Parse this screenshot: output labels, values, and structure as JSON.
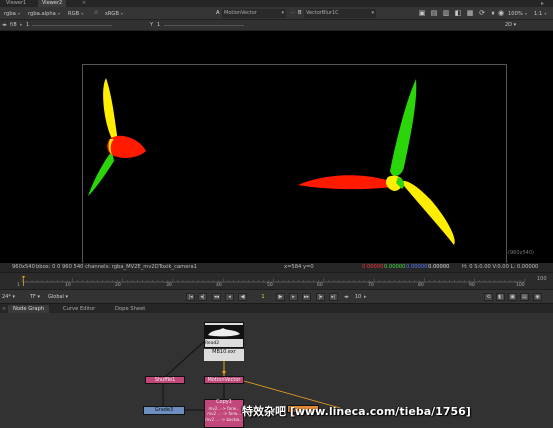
{
  "tabs": [
    {
      "label": "Viewer1",
      "active": false
    },
    {
      "label": "Viewer2",
      "active": true
    }
  ],
  "toolbar": {
    "channels": "rgba",
    "alpha": "rgba.alpha",
    "colorspace_mode": "RGB",
    "colorspace": "sRGB",
    "input_a_letter": "A",
    "input_a": "MotionVector",
    "input_b_letter": "B",
    "input_b": "VectorBlur1C",
    "zoom": "100%",
    "ratio": "1:1"
  },
  "toolbar2": {
    "fstop": "f/8",
    "frame": "1",
    "y_label": "Y",
    "y_value": "1",
    "view_mode": "2D"
  },
  "viewer": {
    "resolution_label": "(960x540)"
  },
  "infobar": {
    "format": "960x540",
    "bbox": "bbox: 0 0 960 540 channels: rgba_MV2E_mv2DToxik_camera1",
    "coords": "x=584 y=0",
    "r": "0.00000",
    "g": "0.00000",
    "b": "0.00000",
    "a": "0.00000",
    "hsvl": "H: 0 S:0.00 V:0.00  L: 0.00000"
  },
  "timeline": {
    "ticks": [
      "1",
      "10",
      "20",
      "30",
      "40",
      "50",
      "60",
      "70",
      "80",
      "90",
      "100"
    ],
    "current_frame_marker": "1",
    "end": "100"
  },
  "playbar": {
    "fps": "24*",
    "tf": "TF",
    "scope": "Global",
    "frame": "1",
    "increment": "10"
  },
  "panel_tabs": [
    {
      "label": "Node Graph",
      "active": true
    },
    {
      "label": "Curve Editor",
      "active": false
    },
    {
      "label": "Dope Sheet",
      "active": false
    }
  ],
  "nodes": {
    "read_name": "Read2",
    "read_file": "MB10.exr",
    "shuffle_left": "Shuffle1",
    "motion_vector": "MotionVector",
    "grade": "Grade3",
    "copy_name": "Copy1",
    "copy_line1": "mv2...-> forw...",
    "copy_line2": "mv2 ... -> forw...",
    "copy_line3": "mv2 ... -> backw..."
  },
  "watermark": "特效杂吧 [www.lineca.com/tieba/1756]",
  "colors": {
    "red": "#ff1a00",
    "green": "#2ad60a",
    "yellow": "#ffee00",
    "node_pink": "#c2477a",
    "node_blue": "#6c8fc0",
    "node_orange": "#e08a3a"
  }
}
